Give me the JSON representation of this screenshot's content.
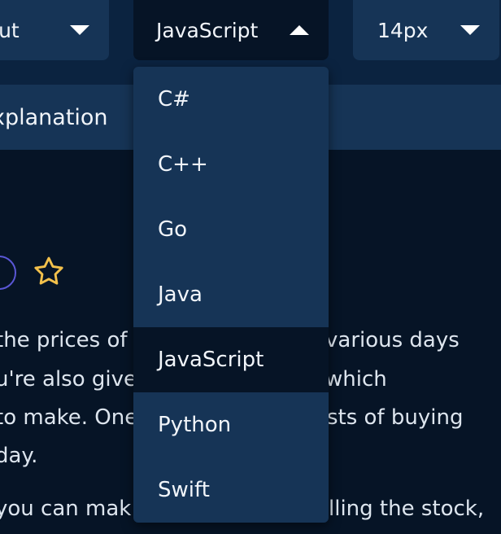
{
  "toolbar": {
    "layout_select": {
      "value": "yout"
    },
    "language_select": {
      "value": "JavaScript",
      "expanded": true
    },
    "font_size_select": {
      "value": "14px"
    }
  },
  "tabs": {
    "explanation_label": "xplanation"
  },
  "language_dropdown": {
    "options": [
      {
        "label": "C#"
      },
      {
        "label": "C++"
      },
      {
        "label": "Go"
      },
      {
        "label": "Java"
      },
      {
        "label": "JavaScript",
        "selected": true
      },
      {
        "label": "Python"
      },
      {
        "label": "Swift"
      }
    ]
  },
  "content": {
    "lines": [
      {
        "left": "the prices of",
        "right": "various days"
      },
      {
        "left": "u're also give",
        "right": "which"
      },
      {
        "left": "to make. One",
        "right": "sts of buying"
      },
      {
        "left": "day.",
        "right": ""
      },
      {
        "left": "you can mak",
        "right": "lling the stock,"
      }
    ]
  },
  "colors": {
    "background": "#061426",
    "panel": "#163456",
    "header": "#0b2340",
    "star": "#f3c14b",
    "circle": "#5a57d6"
  }
}
